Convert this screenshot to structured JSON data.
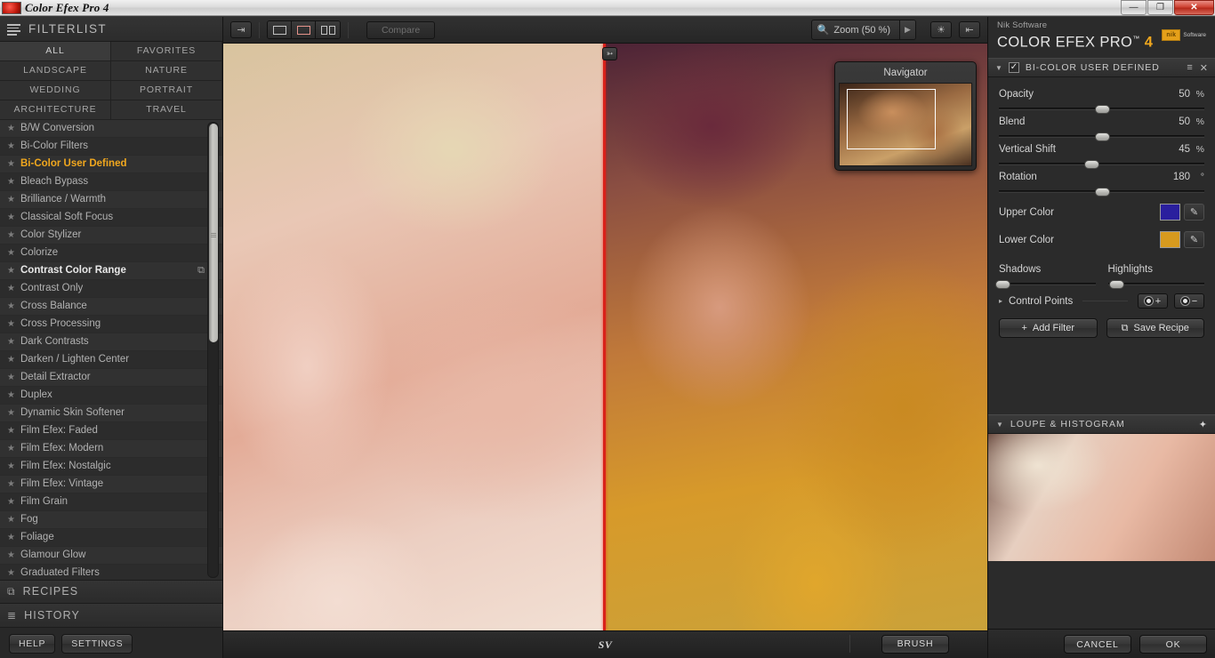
{
  "window": {
    "title": "Color Efex Pro 4",
    "minimize_label": "—",
    "restore_label": "❐",
    "close_label": "✕"
  },
  "left_panel": {
    "title": "FILTERLIST",
    "menu_icon": "hamburger-icon",
    "categories": [
      {
        "label": "ALL",
        "selected": true
      },
      {
        "label": "FAVORITES",
        "selected": false
      },
      {
        "label": "LANDSCAPE",
        "selected": false
      },
      {
        "label": "NATURE",
        "selected": false
      },
      {
        "label": "WEDDING",
        "selected": false
      },
      {
        "label": "PORTRAIT",
        "selected": false
      },
      {
        "label": "ARCHITECTURE",
        "selected": false
      },
      {
        "label": "TRAVEL",
        "selected": false
      }
    ],
    "star_glyph": "★",
    "filters": [
      {
        "label": "B/W Conversion",
        "state": "normal"
      },
      {
        "label": "Bi-Color Filters",
        "state": "normal"
      },
      {
        "label": "Bi-Color User Defined",
        "state": "active"
      },
      {
        "label": "Bleach Bypass",
        "state": "normal"
      },
      {
        "label": "Brilliance / Warmth",
        "state": "normal"
      },
      {
        "label": "Classical Soft Focus",
        "state": "normal"
      },
      {
        "label": "Color Stylizer",
        "state": "normal"
      },
      {
        "label": "Colorize",
        "state": "normal"
      },
      {
        "label": "Contrast Color Range",
        "state": "hover",
        "badge": "⧉"
      },
      {
        "label": "Contrast Only",
        "state": "normal"
      },
      {
        "label": "Cross Balance",
        "state": "normal"
      },
      {
        "label": "Cross Processing",
        "state": "normal"
      },
      {
        "label": "Dark Contrasts",
        "state": "normal"
      },
      {
        "label": "Darken / Lighten Center",
        "state": "normal"
      },
      {
        "label": "Detail Extractor",
        "state": "normal"
      },
      {
        "label": "Duplex",
        "state": "normal"
      },
      {
        "label": "Dynamic Skin Softener",
        "state": "normal"
      },
      {
        "label": "Film Efex: Faded",
        "state": "normal"
      },
      {
        "label": "Film Efex: Modern",
        "state": "normal"
      },
      {
        "label": "Film Efex: Nostalgic",
        "state": "normal"
      },
      {
        "label": "Film Efex: Vintage",
        "state": "normal"
      },
      {
        "label": "Film Grain",
        "state": "normal"
      },
      {
        "label": "Fog",
        "state": "normal"
      },
      {
        "label": "Foliage",
        "state": "normal"
      },
      {
        "label": "Glamour Glow",
        "state": "normal"
      },
      {
        "label": "Graduated Filters",
        "state": "normal"
      }
    ],
    "sections": [
      {
        "label": "RECIPES",
        "icon": "⧉"
      },
      {
        "label": "HISTORY",
        "icon": "≣"
      }
    ],
    "footer_buttons": [
      {
        "label": "HELP"
      },
      {
        "label": "SETTINGS"
      }
    ]
  },
  "toolbar": {
    "export_icon": "export-icon",
    "view_single_icon": "single-view-icon",
    "view_split_icon": "split-view-icon",
    "view_sidebyside_icon": "side-by-side-view-icon",
    "compare_label": "Compare",
    "zoom_label": "Zoom (50 %)",
    "zoom_search_icon": "🔍",
    "zoom_arrow": "▶",
    "brightness_icon": "brightness-icon",
    "fullscreen_icon": "fullscreen-icon"
  },
  "canvas": {
    "navigator": {
      "title": "Navigator"
    },
    "split_handle_icon": "split-handle-icon"
  },
  "statusbar": {
    "text": "SV"
  },
  "right_panel": {
    "brand": {
      "vendor": "Nik Software",
      "product": "COLOR EFEX PRO",
      "trademark": "™",
      "version": "4",
      "logo_mark": "nik",
      "logo_word": "Software"
    },
    "filter_header": {
      "caret": "▼",
      "check": "✓",
      "name": "BI-COLOR USER DEFINED",
      "menu_icon": "≡",
      "close_icon": "✕"
    },
    "sliders": [
      {
        "label": "Opacity",
        "value": "50",
        "unit": "%",
        "percent": 50
      },
      {
        "label": "Blend",
        "value": "50",
        "unit": "%",
        "percent": 50
      },
      {
        "label": "Vertical Shift",
        "value": "45",
        "unit": "%",
        "percent": 45
      },
      {
        "label": "Rotation",
        "value": "180",
        "unit": "°",
        "percent": 50
      }
    ],
    "colors": [
      {
        "label": "Upper Color",
        "hex": "#2a1f9e",
        "picker_icon": "eyedropper-icon"
      },
      {
        "label": "Lower Color",
        "hex": "#d79a1e",
        "picker_icon": "eyedropper-icon"
      }
    ],
    "tonal": [
      {
        "label": "Shadows",
        "percent": 3
      },
      {
        "label": "Highlights",
        "percent": 8
      }
    ],
    "control_points": {
      "caret": "▸",
      "label": "Control Points",
      "add_label": "+",
      "remove_label": "−"
    },
    "actions": [
      {
        "label": "Add Filter",
        "icon": "+"
      },
      {
        "label": "Save Recipe",
        "icon": "⧉"
      }
    ],
    "loupe": {
      "caret": "▼",
      "label": "LOUPE & HISTOGRAM",
      "pin_icon": "pin-icon"
    },
    "footer_buttons": [
      {
        "label": "BRUSH"
      },
      {
        "label": "CANCEL"
      },
      {
        "label": "OK"
      }
    ]
  },
  "theme": {
    "accent": "#f0a71e",
    "split_line": "#d9211a",
    "panel_bg": "#2b2b2b"
  }
}
